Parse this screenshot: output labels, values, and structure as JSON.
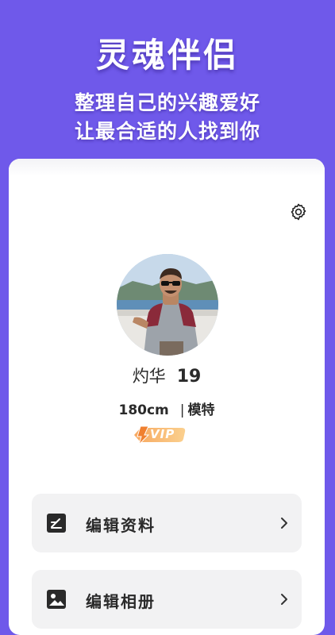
{
  "hero": {
    "title": "灵魂伴侣",
    "subtitle_line1": "整理自己的兴趣爱好",
    "subtitle_line2": "让最合适的人找到你"
  },
  "profile": {
    "name": "灼华",
    "age": "19",
    "height": "180cm",
    "separator": "|",
    "occupation": "模特",
    "badge": "VIP"
  },
  "menu": {
    "items": [
      {
        "label": "编辑资料",
        "icon": "edit-document-icon"
      },
      {
        "label": "编辑相册",
        "icon": "photo-album-icon"
      }
    ]
  },
  "colors": {
    "background": "#6f59ea",
    "card": "#ffffff",
    "menu_item_bg": "#f2f2f3",
    "vip_gradient_start": "#f7a860",
    "vip_gradient_end": "#fbd08e"
  }
}
